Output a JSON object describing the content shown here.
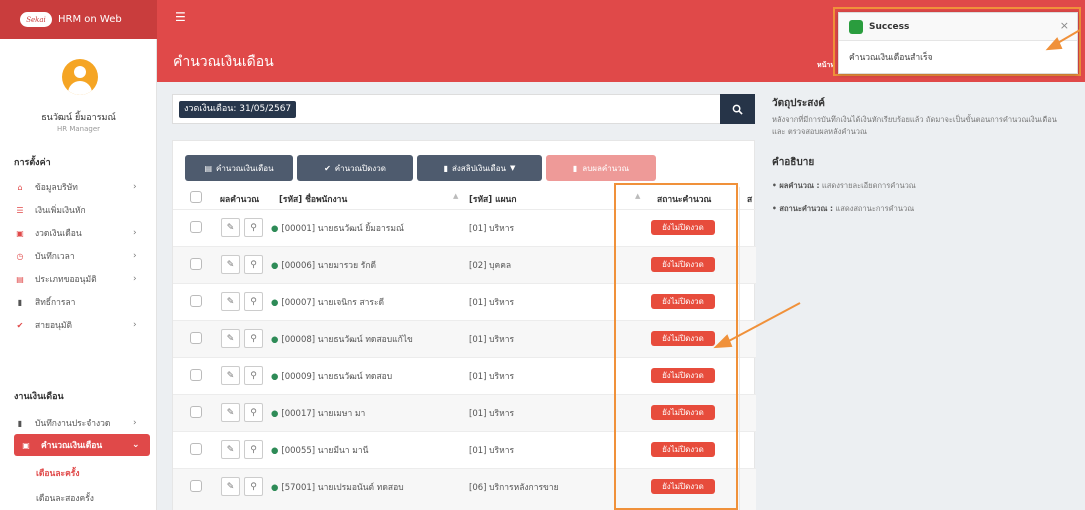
{
  "app": {
    "name": "HRM on Web",
    "logo_text": "Sekai",
    "menu_icon": "hamburger-icon"
  },
  "user": {
    "name": "ธนวัฒน์ ยิ้มอารมณ์",
    "role": "HR Manager"
  },
  "sidebar": {
    "section1": "การตั้งค่า",
    "section2": "งานเงินเดือน",
    "items": [
      {
        "label": "ข้อมูลบริษัท",
        "icon": "home-icon"
      },
      {
        "label": "เงินเพิ่มเงินหัก",
        "icon": "list-icon"
      },
      {
        "label": "งวดเงินเดือน",
        "icon": "money-icon"
      },
      {
        "label": "บันทึกเวลา",
        "icon": "clock-icon"
      },
      {
        "label": "ประเภทขออนุมัติ",
        "icon": "table-icon"
      },
      {
        "label": "สิทธิ์การลา",
        "icon": "file-icon"
      },
      {
        "label": "สายอนุมัติ",
        "icon": "check-circle-icon"
      }
    ],
    "payroll_items": [
      {
        "label": "บันทึกงานประจำงวด",
        "icon": "book-icon"
      },
      {
        "label": "คำนวณเงินเดือน",
        "icon": "money-icon"
      }
    ],
    "sub_items": [
      "เดือนละครั้ง",
      "เดือนละสองครั้ง"
    ]
  },
  "header": {
    "title": "คำนวณเงินเดือน",
    "breadcrumb": "หน้าห"
  },
  "search": {
    "period_tag": "งวดเงินเดือน: 31/05/2567"
  },
  "toolbar": {
    "calc": "คำนวณเงินเดือน",
    "close": "คำนวณปิดงวด",
    "export": "ส่งสลิปเงินเดือน",
    "delete": "ลบผลคำนวณ"
  },
  "table": {
    "headers": {
      "result": "ผลคำนวณ",
      "employee": "[รหัส] ชื่อพนักงาน",
      "dept": "[รหัส] แผนก",
      "status": "สถานะคำนวณ",
      "extra": "ส"
    },
    "rows": [
      {
        "employee": "[00001] นายธนวัฒน์ ยิ้มอารมณ์",
        "dept": "[01] บริหาร",
        "status": "ยังไม่ปิดงวด"
      },
      {
        "employee": "[00006] นายมารวย รักดี",
        "dept": "[02] บุคคล",
        "status": "ยังไม่ปิดงวด"
      },
      {
        "employee": "[00007] นายเจนิกร สาระดี",
        "dept": "[01] บริหาร",
        "status": "ยังไม่ปิดงวด"
      },
      {
        "employee": "[00008] นายธนวัฒน์ ทดสอบแก้ไข",
        "dept": "[01] บริหาร",
        "status": "ยังไม่ปิดงวด"
      },
      {
        "employee": "[00009] นายธนวัฒน์ ทดสอบ",
        "dept": "[01] บริหาร",
        "status": "ยังไม่ปิดงวด"
      },
      {
        "employee": "[00017] นายเมษา มา",
        "dept": "[01] บริหาร",
        "status": "ยังไม่ปิดงวด"
      },
      {
        "employee": "[00055] นายมีนา มานี",
        "dept": "[01] บริหาร",
        "status": "ยังไม่ปิดงวด"
      },
      {
        "employee": "[57001] นายเปรมอนันต์ ทดสอบ",
        "dept": "[06] บริการหลังการขาย",
        "status": "ยังไม่ปิดงวด"
      }
    ]
  },
  "info": {
    "objective_title": "วัตถุประสงค์",
    "objective_text": "หลังจากที่มีการบันทึกเงินได้เงินหักเรียบร้อยแล้ว ถัดมาจะเป็นขั้นตอนการคำนวณเงินเดือน และ ตรวจสอบผลหลังคำนวณ",
    "desc_title": "คำอธิบาย",
    "desc1_term": "• ผลคำนวณ :",
    "desc1_text": " แสดงรายละเอียดการคำนวณ",
    "desc2_term": "• สถานะคำนวณ :",
    "desc2_text": " แสดงสถานะการคำนวณ"
  },
  "toast": {
    "title": "Success",
    "message": "คำนวณเงินเดือนสำเร็จ",
    "close": "×"
  },
  "colors": {
    "primary": "#e04949",
    "dark": "#263448",
    "status": "#e74c3c",
    "highlight": "#f0913a",
    "success": "#2a9d3e"
  }
}
